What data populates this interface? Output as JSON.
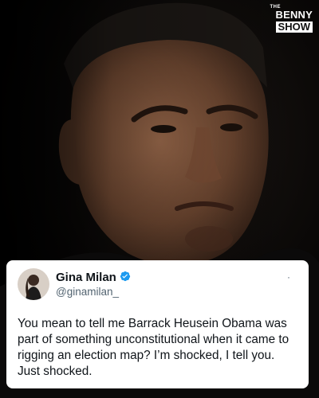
{
  "brand": {
    "small": "THE",
    "line1": "BENNY",
    "line2": "SHOW"
  },
  "tweet": {
    "name": "Gina Milan",
    "handle": "@ginamilan_",
    "text": "You mean to tell me Barrack Heusein Obama was\npart of something unconstitutional when it came to\nrigging an election map? I’m shocked, I tell you.\nJust shocked."
  },
  "colors": {
    "verified": "#1d9bf0",
    "text": "#0f1419",
    "secondary": "#536471"
  },
  "icons": {
    "verified": "verified-badge-icon",
    "more": "more-icon"
  }
}
